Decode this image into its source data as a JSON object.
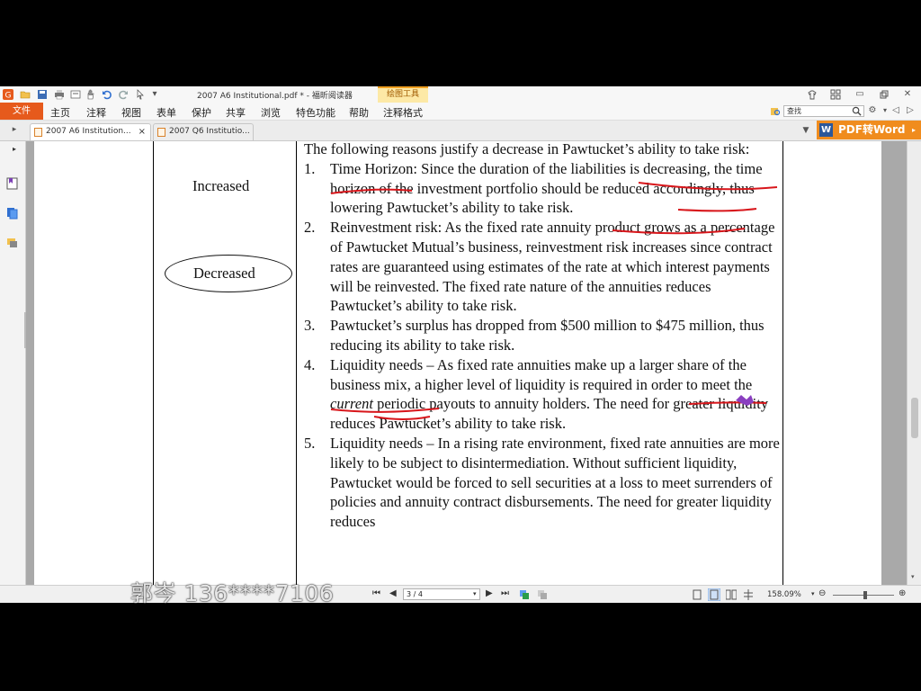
{
  "app": {
    "window_title": "2007 A6 Institutional.pdf * - 福昕阅读器",
    "context_tab": "绘图工具",
    "file_menu": "文件",
    "menu_items": [
      "主页",
      "注释",
      "视图",
      "表单",
      "保护",
      "共享",
      "浏览",
      "特色功能",
      "帮助",
      "注释格式"
    ],
    "search_placeholder": "查找",
    "pdf_to_word": "PDF转Word",
    "word_icon_letter": "W",
    "accent_color": "#e65a1c"
  },
  "tabs": [
    {
      "label": "2007 A6 Institution...",
      "active": true,
      "close": "×"
    },
    {
      "label": "2007 Q6 Institutio...",
      "active": false
    }
  ],
  "document": {
    "left_col_increased": "Increased",
    "left_col_decreased": "Decreased",
    "intro": "The following reasons justify a decrease in Pawtucket’s ability to take risk:",
    "items": [
      {
        "num": "1.",
        "text": "Time Horizon: Since the duration of the liabilities is decreasing, the time horizon of the investment portfolio should be reduced accordingly, thus lowering Pawtucket’s ability to take risk."
      },
      {
        "num": "2.",
        "text": "Reinvestment risk: As the fixed rate annuity product grows as a percentage of Pawtucket Mutual’s business, reinvestment risk increases since contract rates are guaranteed using estimates of the rate at which interest payments will be reinvested. The fixed rate nature of the annuities reduces Pawtucket’s ability to take risk."
      },
      {
        "num": "3.",
        "text": "Pawtucket’s surplus has dropped from $500 million to $475 million, thus reducing its ability to take risk."
      },
      {
        "num": "4.",
        "text_a": "Liquidity needs – As fixed rate annuities make up a larger share of the business mix, a higher level of liquidity is required in order to meet the ",
        "text_em": "current",
        "text_b": " periodic payouts to annuity holders. The need for greater liquidity reduces Pawtucket’s ability to take risk."
      },
      {
        "num": "5.",
        "text": "Liquidity needs – In a rising rate environment, fixed rate annuities are more likely to be subject to disintermediation. Without sufficient liquidity, Pawtucket would be forced to sell securities at a loss to meet surrenders of policies and annuity contract disbursements. The need for greater liquidity reduces"
      }
    ]
  },
  "status": {
    "page_indicator": "3 / 4",
    "zoom": "158.09%"
  },
  "watermark": "郭岑 136****7106"
}
